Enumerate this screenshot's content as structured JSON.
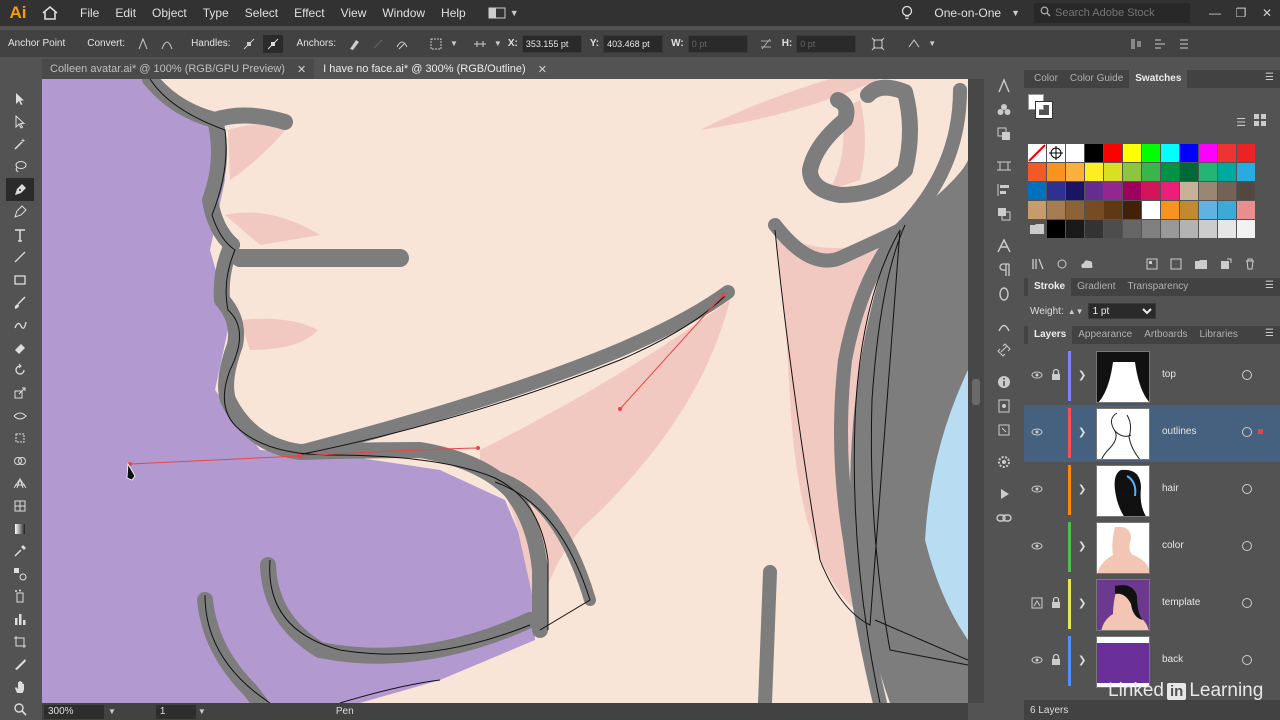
{
  "app": {
    "logo": "Ai"
  },
  "menu": {
    "items": [
      "File",
      "Edit",
      "Object",
      "Type",
      "Select",
      "Effect",
      "View",
      "Window",
      "Help"
    ]
  },
  "workspace": {
    "label": "One-on-One"
  },
  "search": {
    "placeholder": "Search Adobe Stock"
  },
  "control_bar": {
    "anchor_point": "Anchor Point",
    "convert": "Convert:",
    "handles": "Handles:",
    "anchors": "Anchors:",
    "x_label": "X:",
    "x_value": "353.155 pt",
    "y_label": "Y:",
    "y_value": "403.468 pt",
    "w_label": "W:",
    "w_value": "0 pt",
    "h_label": "H:",
    "h_value": "0 pt"
  },
  "tabs": [
    {
      "label": "Colleen avatar.ai* @ 100% (RGB/GPU Preview)",
      "active": false
    },
    {
      "label": "I have no face.ai* @ 300% (RGB/Outline)",
      "active": true
    }
  ],
  "status": {
    "zoom": "300%",
    "artboard": "1",
    "tool": "Pen"
  },
  "swatch_panel": {
    "tabs": [
      "Color",
      "Color Guide",
      "Swatches"
    ],
    "rows": [
      [
        "none",
        "registration",
        "#ffffff",
        "#000000",
        "#ff0000",
        "#ffff00",
        "#00ff00",
        "#00ffff",
        "#0000ff",
        "#ff00ff",
        "#ee3333",
        "#ee2222"
      ],
      [
        "#f15a24",
        "#f7931e",
        "#fbb03b",
        "#fcee21",
        "#d9e021",
        "#8cc63f",
        "#39b54a",
        "#009245",
        "#006837",
        "#22b573",
        "#00a99d",
        "#29abe2"
      ],
      [
        "#0071bc",
        "#2e3192",
        "#1b1464",
        "#662d91",
        "#93278f",
        "#9e005d",
        "#d4145a",
        "#ed1e79",
        "#c7b299",
        "#998675",
        "#736357",
        "#534741"
      ],
      [
        "#c69c6d",
        "#a67c52",
        "#8c6239",
        "#754c24",
        "#603813",
        "#42210b",
        "#ffffff",
        "#f7931e",
        "#c08a2e",
        "#5fb3e0",
        "#3da9d9",
        "#e98e8e"
      ],
      [
        "folder",
        "#000000",
        "#1a1a1a",
        "#333333",
        "#4d4d4d",
        "#666666",
        "#808080",
        "#999999",
        "#b3b3b3",
        "#cccccc",
        "#e6e6e6",
        "#f2f2f2"
      ]
    ]
  },
  "stroke_panel": {
    "tabs": [
      "Stroke",
      "Gradient",
      "Transparency"
    ],
    "weight_label": "Weight:",
    "weight_value": "1 pt"
  },
  "layers_panel": {
    "tabs": [
      "Layers",
      "Appearance",
      "Artboards",
      "Libraries"
    ],
    "layers": [
      {
        "name": "top",
        "color": "#7f7fff",
        "locked": true,
        "selected": false
      },
      {
        "name": "outlines",
        "color": "#ff4f4f",
        "locked": false,
        "selected": true
      },
      {
        "name": "hair",
        "color": "#ff8a00",
        "locked": false,
        "selected": false
      },
      {
        "name": "color",
        "color": "#4fbf4f",
        "locked": false,
        "selected": false
      },
      {
        "name": "template",
        "color": "#e8e84f",
        "locked": true,
        "selected": false
      },
      {
        "name": "back",
        "color": "#4f8fff",
        "locked": true,
        "selected": false
      }
    ],
    "footer": "6 Layers"
  },
  "watermark": {
    "pre": "Linked",
    "in": "in",
    "post": "Learning"
  }
}
